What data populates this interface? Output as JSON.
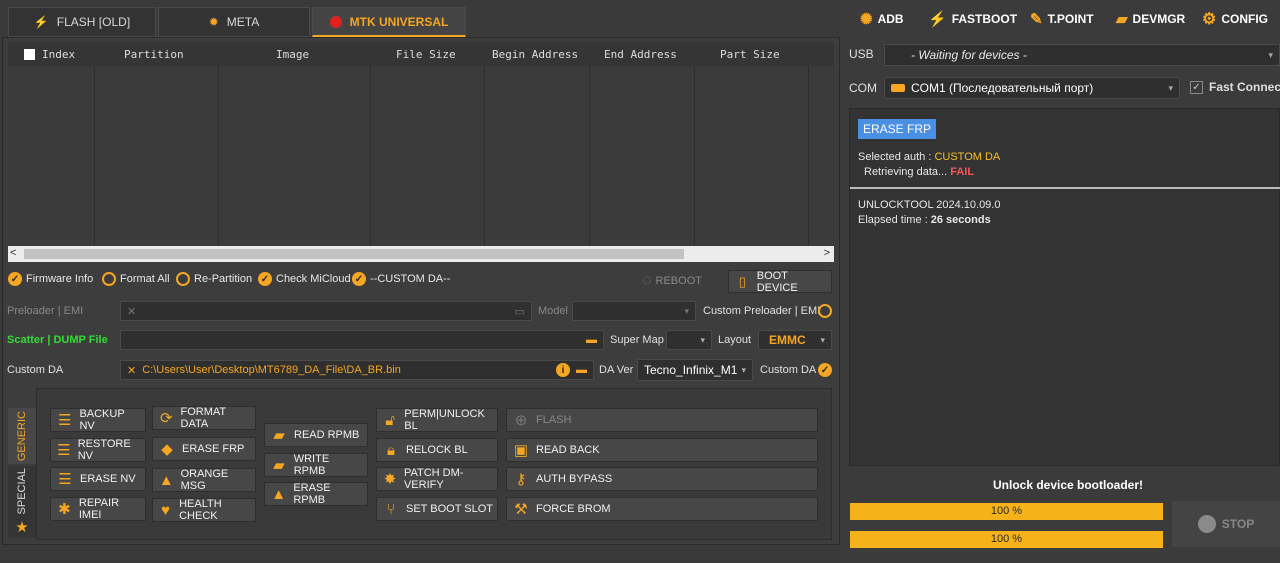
{
  "tabs": [
    {
      "label": "FLASH [OLD]",
      "icon": "bolt-icon"
    },
    {
      "label": "META",
      "icon": "gear-icon"
    },
    {
      "label": "MTK UNIVERSAL",
      "icon": "red-dot-icon"
    }
  ],
  "grid": {
    "headers": [
      "Index",
      "Partition",
      "Image",
      "File Size",
      "Begin Address",
      "End Address",
      "Part Size"
    ]
  },
  "options": {
    "firmware_info": "Firmware Info",
    "format_all": "Format All",
    "re_partition": "Re-Partition",
    "check_micloud": "Check MiCloud",
    "custom_da_opt": "--CUSTOM DA--",
    "reboot": "REBOOT",
    "boot_device": "BOOT DEVICE"
  },
  "fields": {
    "preloader_label": "Preloader | EMI",
    "model_label": "Model",
    "custom_preloader_label": "Custom Preloader | EMI",
    "scatter_label": "Scatter | DUMP File",
    "super_map_label": "Super Map",
    "layout_label": "Layout",
    "layout_value": "EMMC",
    "custom_da_label": "Custom DA",
    "custom_da_path": "C:\\Users\\User\\Desktop\\MT6789_DA_File\\DA_BR.bin",
    "da_ver_label": "DA Ver",
    "da_ver_value": "Tecno_Infinix_M1",
    "custom_da_right": "Custom DA"
  },
  "side_tabs": {
    "generic": "GENERIC",
    "special": "SPECIAL"
  },
  "actions": {
    "backup_nv": "BACKUP NV",
    "restore_nv": "RESTORE NV",
    "erase_nv": "ERASE NV",
    "repair_imei": "REPAIR IMEI",
    "format_data": "FORMAT DATA",
    "erase_frp": "ERASE FRP",
    "orange_msg": "ORANGE MSG",
    "health_check": "HEALTH CHECK",
    "read_rpmb": "READ RPMB",
    "write_rpmb": "WRITE RPMB",
    "erase_rpmb": "ERASE RPMB",
    "perm_unlock_bl": "PERM|UNLOCK BL",
    "relock_bl": "RELOCK BL",
    "patch_dm_verify": "PATCH DM-VERIFY",
    "set_boot_slot": "SET BOOT SLOT",
    "flash": "FLASH",
    "read_back": "READ BACK",
    "auth_bypass": "AUTH BYPASS",
    "force_brom": "FORCE BROM"
  },
  "right": {
    "top_buttons": [
      "ADB",
      "FASTBOOT",
      "T.POINT",
      "DEVMGR",
      "CONFIG"
    ],
    "usb_label": "USB",
    "usb_value": "- Waiting for devices -",
    "com_label": "COM",
    "com_value": "COM1 (Последовательный порт)",
    "fast_connect": "Fast Connect"
  },
  "log": {
    "title": "ERASE FRP",
    "auth_label": "Selected auth : ",
    "auth_value": "CUSTOM DA",
    "retrieving": "Retrieving data... ",
    "fail": "FAIL",
    "version_label": "UNLOCKTOOL ",
    "version_value": "2024.10.09.0",
    "elapsed_label": "Elapsed time : ",
    "elapsed_value": "26 seconds"
  },
  "status": {
    "message": "Unlock device bootloader!",
    "progress1": "100 %",
    "progress2": "100 %",
    "progress1_value": 100,
    "progress2_value": 100,
    "stop": "STOP"
  },
  "colors": {
    "accent": "#f5a623",
    "fail": "#ff5555",
    "green": "#33dd33",
    "blue": "#4a90e2"
  }
}
